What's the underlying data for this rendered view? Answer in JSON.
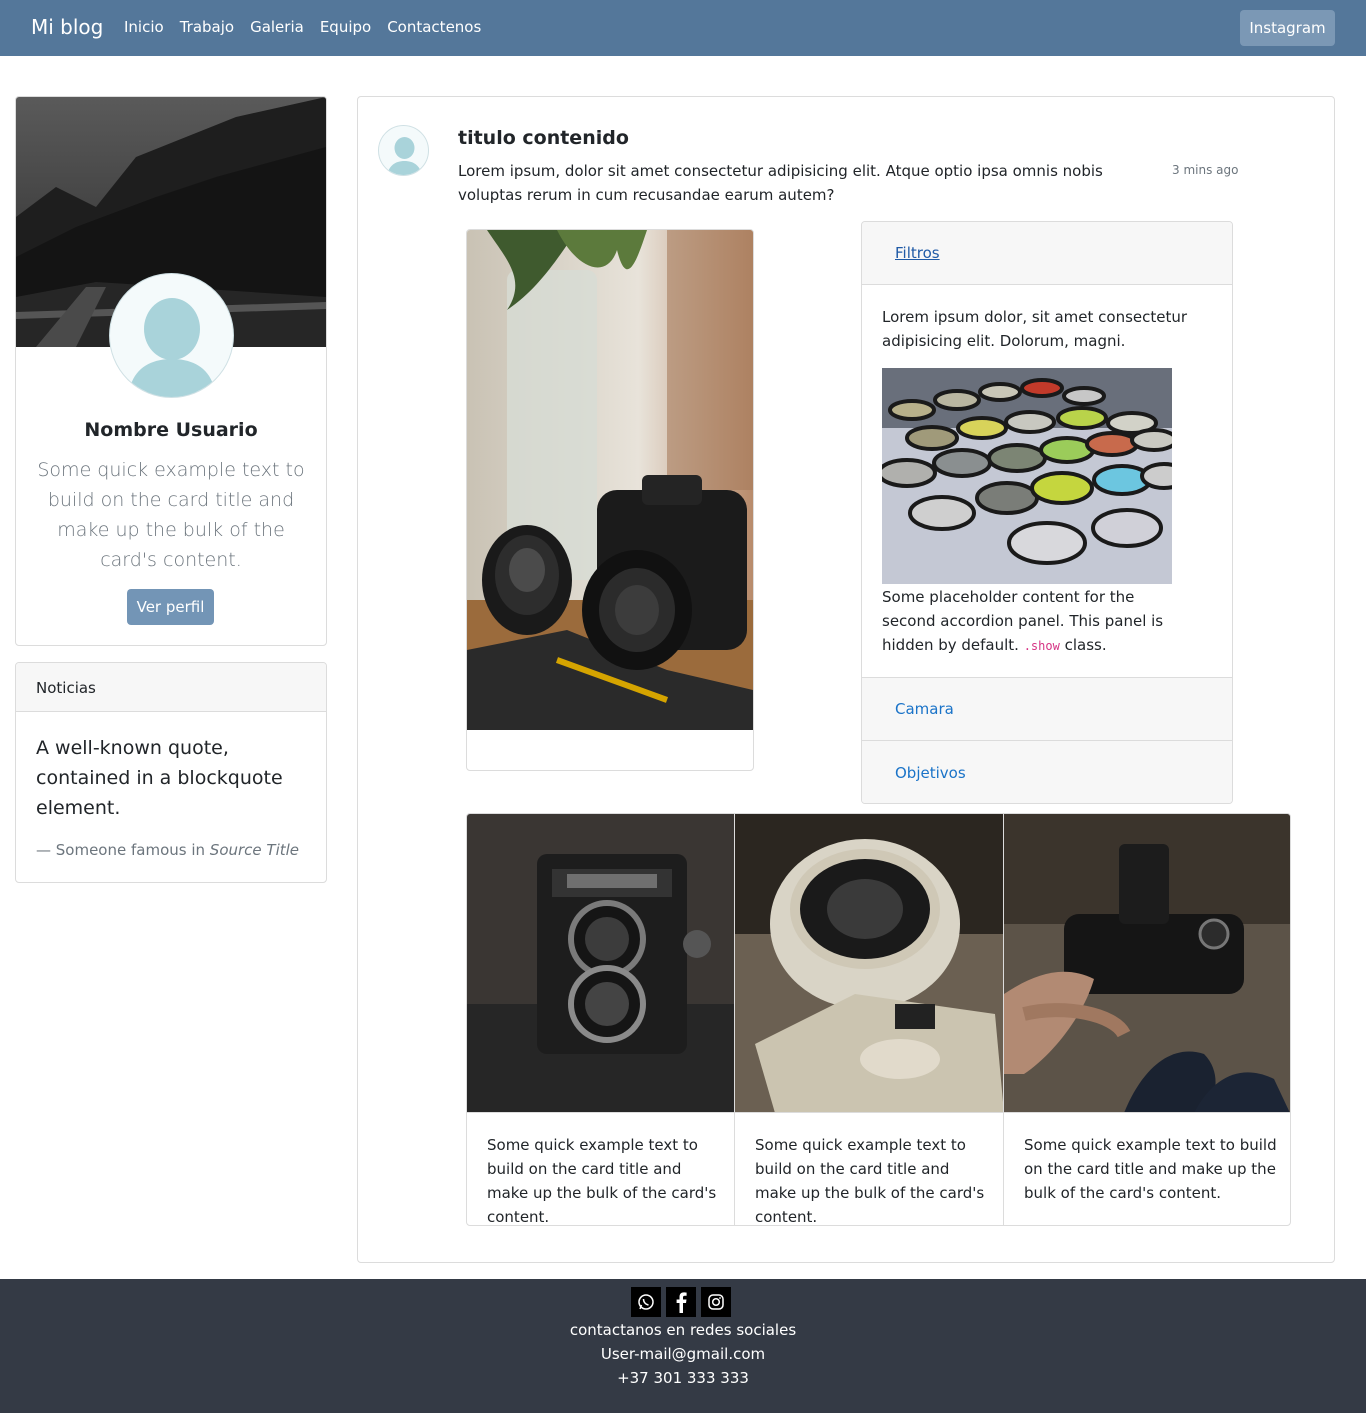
{
  "navbar": {
    "brand": "Mi blog",
    "links": [
      "Inicio",
      "Trabajo",
      "Galeria",
      "Equipo",
      "Contactenos"
    ],
    "instagram_label": "Instagram",
    "color": "#54779a"
  },
  "profile": {
    "name": "Nombre Usuario",
    "text": "Some quick example text to build on the card title and make up the bulk of the card's content.",
    "button": "Ver perfil"
  },
  "news": {
    "header": "Noticias",
    "quote": "A well-known quote, contained in a blockquote element.",
    "footer_prefix": "— Someone famous in ",
    "footer_source": "Source Title"
  },
  "post": {
    "title": "titulo contenido",
    "text": "Lorem ipsum, dolor sit amet consectetur adipisicing elit. Atque optio ipsa omnis nobis voluptas rerum in cum recusandae earum autem?",
    "time": "3 mins ago"
  },
  "accordion": {
    "items": [
      {
        "label": "Filtros"
      },
      {
        "label": "Camara"
      },
      {
        "label": "Objetivos"
      }
    ],
    "body_text": "Lorem ipsum dolor, sit amet consectetur adipisicing elit. Dolorum, magni.",
    "body_text2_prefix": "Some placeholder content for the second accordion panel. This panel is hidden by default. ",
    "body_code": ".show",
    "body_text2_suffix": " class."
  },
  "gallery": {
    "cards": [
      {
        "text": "Some quick example text to build on the card title and make up the bulk of the card's content."
      },
      {
        "text": "Some quick example text to build on the card title and make up the bulk of the card's content."
      },
      {
        "text": "Some quick example text to build on the card title and make up the bulk of the card's content."
      }
    ]
  },
  "footer": {
    "social_icons": [
      "whatsapp-icon",
      "facebook-icon",
      "instagram-icon"
    ],
    "line1": "contactanos en redes sociales",
    "email": "User-mail@gmail.com",
    "phone": "+37 301 333 333"
  }
}
